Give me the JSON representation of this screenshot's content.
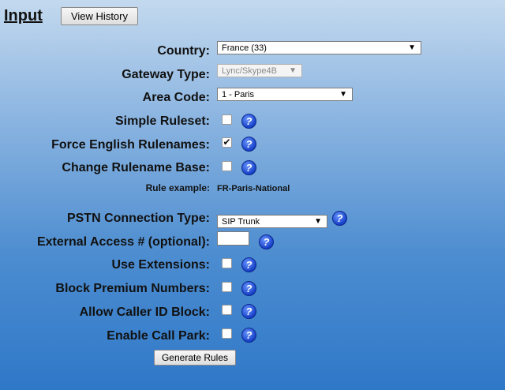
{
  "heading": "Input",
  "view_history_button": "View History",
  "fields": {
    "country": {
      "label": "Country:",
      "value": "France (33)"
    },
    "gateway_type": {
      "label": "Gateway Type:",
      "value": "Lync/Skype4B"
    },
    "area_code": {
      "label": "Area Code:",
      "value": "1 - Paris"
    },
    "simple_ruleset": {
      "label": "Simple Ruleset:",
      "checked": false
    },
    "force_english": {
      "label": "Force English Rulenames:",
      "checked": true
    },
    "change_rulename_base": {
      "label": "Change Rulename Base:",
      "checked": false
    },
    "rule_example": {
      "label": "Rule example:",
      "value": "FR-Paris-National"
    },
    "pstn_connection_type": {
      "label": "PSTN Connection Type:",
      "value": "SIP Trunk"
    },
    "external_access": {
      "label": "External Access # (optional):",
      "value": ""
    },
    "use_extensions": {
      "label": "Use Extensions:",
      "checked": false
    },
    "block_premium": {
      "label": "Block Premium Numbers:",
      "checked": false
    },
    "allow_caller_id_block": {
      "label": "Allow Caller ID Block:",
      "checked": false
    },
    "enable_call_park": {
      "label": "Enable Call Park:",
      "checked": false
    }
  },
  "icons": {
    "dropdown_arrow": "▼",
    "checkmark": "✔",
    "help": "?"
  },
  "generate_button": "Generate Rules"
}
